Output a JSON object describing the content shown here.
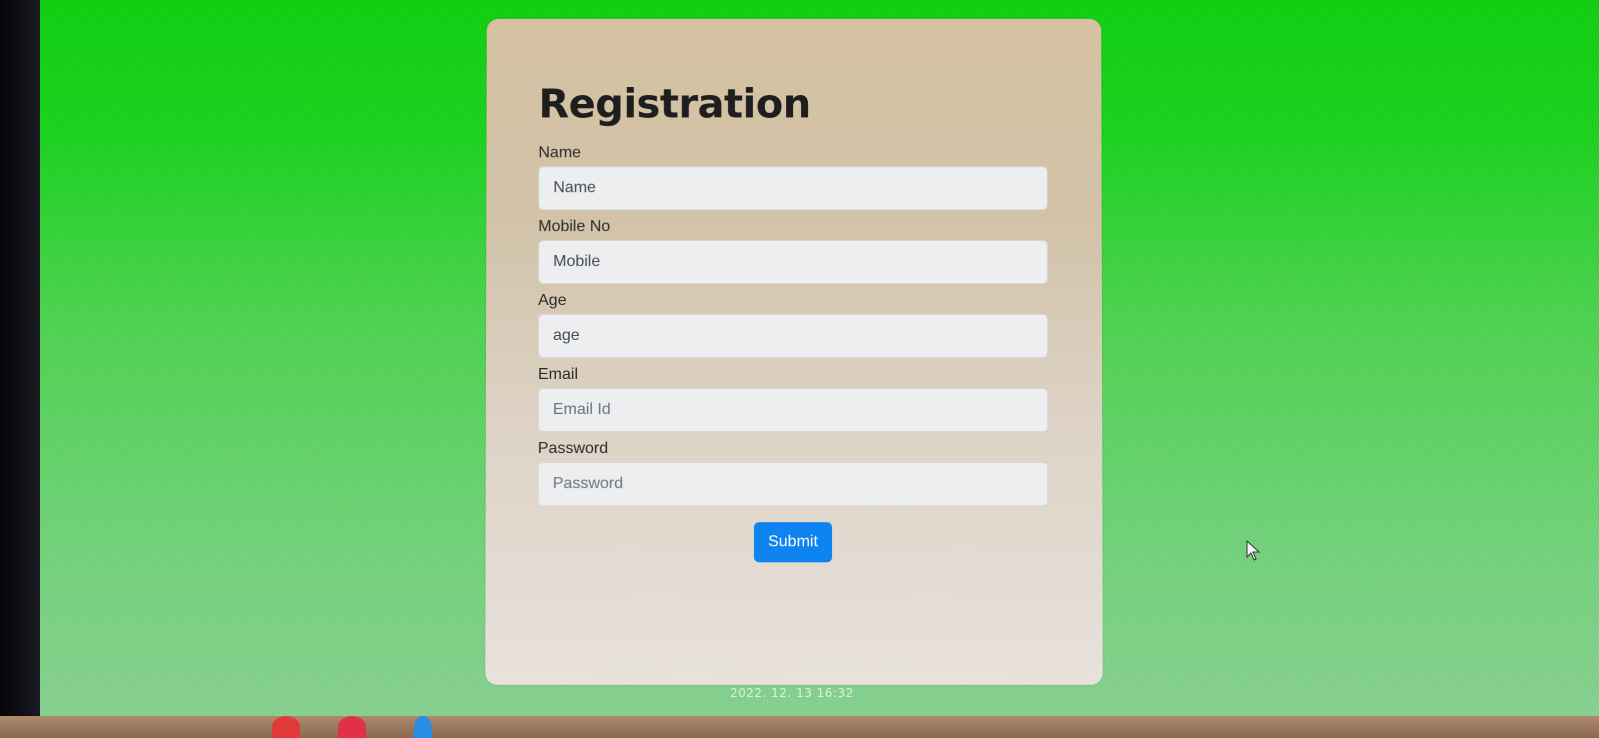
{
  "form": {
    "title": "Registration",
    "fields": [
      {
        "label": "Name",
        "placeholder": "Name"
      },
      {
        "label": "Mobile No",
        "placeholder": "Mobile"
      },
      {
        "label": "Age",
        "placeholder": "age"
      },
      {
        "label": "Email",
        "placeholder": "Email Id"
      },
      {
        "label": "Password",
        "placeholder": "Password"
      }
    ],
    "submit_label": "Submit"
  },
  "overlay": {
    "timestamp": "2022. 12. 13 16:32"
  },
  "colors": {
    "background": "#17d21a",
    "card": "#d6c2a2",
    "button": "#0d84ef"
  }
}
